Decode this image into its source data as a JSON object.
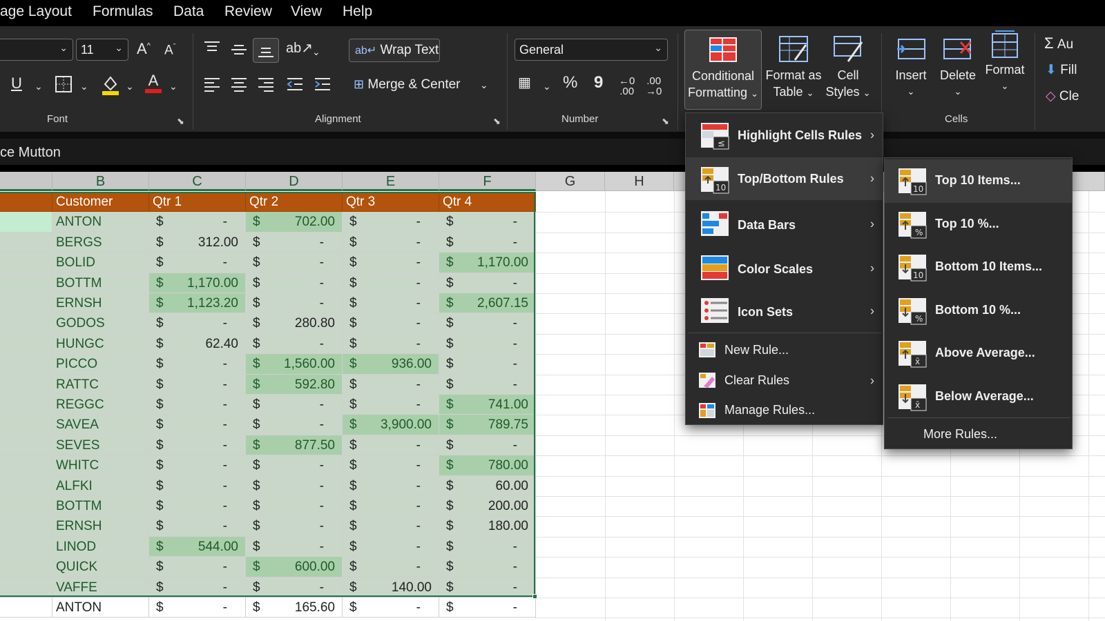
{
  "menubar": {
    "items": [
      "age Layout",
      "Formulas",
      "Data",
      "Review",
      "View",
      "Help"
    ]
  },
  "ribbon": {
    "font": {
      "size_value": "11",
      "grow_icon": "font-grow-icon",
      "shrink_icon": "font-shrink-icon",
      "group_label": "Font",
      "underline_glyph": "U",
      "color_glyph": "A",
      "fill_color": "#f5d800",
      "font_color": "#e01c1c"
    },
    "alignment": {
      "wrap_text": "Wrap Text",
      "merge_center": "Merge & Center",
      "group_label": "Alignment"
    },
    "number": {
      "format_value": "General",
      "percent_glyph": "%",
      "comma_glyph": "9",
      "group_label": "Number"
    },
    "styles": {
      "conditional_formatting": [
        "Conditional",
        "Formatting"
      ],
      "format_as_table": [
        "Format as",
        "Table"
      ],
      "cell_styles": [
        "Cell",
        "Styles"
      ]
    },
    "cells": {
      "insert": "Insert",
      "delete": "Delete",
      "format": "Format",
      "group_label": "Cells"
    },
    "editing": {
      "autosum": "Au",
      "fill": "Fill",
      "clear": "Cle"
    }
  },
  "formula_bar": {
    "text": "ce Mutton"
  },
  "sheet": {
    "columns": [
      "B",
      "C",
      "D",
      "E",
      "F",
      "G",
      "H"
    ],
    "headers": [
      "Customer",
      "Qtr 1",
      "Qtr 2",
      "Qtr 3",
      "Qtr 4"
    ],
    "currency_symbol": "$",
    "rows": [
      {
        "customer": "ANTON",
        "q": [
          "-",
          "702.00",
          "-",
          "-"
        ]
      },
      {
        "customer": "BERGS",
        "q": [
          "312.00",
          "-",
          "-",
          "-"
        ]
      },
      {
        "customer": "BOLID",
        "q": [
          "-",
          "-",
          "-",
          "1,170.00"
        ]
      },
      {
        "customer": "BOTTM",
        "q": [
          "1,170.00",
          "-",
          "-",
          "-"
        ]
      },
      {
        "customer": "ERNSH",
        "q": [
          "1,123.20",
          "-",
          "-",
          "2,607.15"
        ]
      },
      {
        "customer": "GODOS",
        "q": [
          "-",
          "280.80",
          "-",
          "-"
        ]
      },
      {
        "customer": "HUNGC",
        "q": [
          "62.40",
          "-",
          "-",
          "-"
        ]
      },
      {
        "customer": "PICCO",
        "q": [
          "-",
          "1,560.00",
          "936.00",
          "-"
        ]
      },
      {
        "customer": "RATTC",
        "q": [
          "-",
          "592.80",
          "-",
          "-"
        ]
      },
      {
        "customer": "REGGC",
        "q": [
          "-",
          "-",
          "-",
          "741.00"
        ]
      },
      {
        "customer": "SAVEA",
        "q": [
          "-",
          "-",
          "3,900.00",
          "789.75"
        ]
      },
      {
        "customer": "SEVES",
        "q": [
          "-",
          "877.50",
          "-",
          "-"
        ]
      },
      {
        "customer": "WHITC",
        "q": [
          "-",
          "-",
          "-",
          "780.00"
        ]
      },
      {
        "customer": "ALFKI",
        "q": [
          "-",
          "-",
          "-",
          "60.00"
        ]
      },
      {
        "customer": "BOTTM",
        "q": [
          "-",
          "-",
          "-",
          "200.00"
        ]
      },
      {
        "customer": "ERNSH",
        "q": [
          "-",
          "-",
          "-",
          "180.00"
        ]
      },
      {
        "customer": "LINOD",
        "q": [
          "544.00",
          "-",
          "-",
          "-"
        ]
      },
      {
        "customer": "QUICK",
        "q": [
          "-",
          "600.00",
          "-",
          "-"
        ]
      },
      {
        "customer": "VAFFE",
        "q": [
          "-",
          "-",
          "140.00",
          "-"
        ]
      },
      {
        "customer": "ANTON",
        "q": [
          "-",
          "165.60",
          "-",
          "-"
        ]
      }
    ],
    "highlighted": [
      [
        false,
        true,
        false,
        false
      ],
      [
        false,
        false,
        false,
        false
      ],
      [
        false,
        false,
        false,
        true
      ],
      [
        true,
        false,
        false,
        false
      ],
      [
        true,
        false,
        false,
        true
      ],
      [
        false,
        false,
        false,
        false
      ],
      [
        false,
        false,
        false,
        false
      ],
      [
        false,
        true,
        true,
        false
      ],
      [
        false,
        true,
        false,
        false
      ],
      [
        false,
        false,
        false,
        true
      ],
      [
        false,
        false,
        true,
        true
      ],
      [
        false,
        true,
        false,
        false
      ],
      [
        false,
        false,
        false,
        true
      ],
      [
        false,
        false,
        false,
        false
      ],
      [
        false,
        false,
        false,
        false
      ],
      [
        false,
        false,
        false,
        false
      ],
      [
        true,
        false,
        false,
        false
      ],
      [
        false,
        true,
        false,
        false
      ],
      [
        false,
        false,
        false,
        false
      ],
      [
        false,
        false,
        false,
        false
      ]
    ],
    "colors": {
      "header_fill": "#b4530b",
      "highlight_fill": "#a9cfaa",
      "selection_border": "#217346"
    }
  },
  "cf_menu": {
    "items": [
      {
        "label": "Highlight Cells Rules",
        "icon": "highlight-cells-icon",
        "submenu": true
      },
      {
        "label": "Top/Bottom Rules",
        "icon": "top-bottom-icon",
        "submenu": true,
        "active": true
      },
      {
        "label": "Data Bars",
        "icon": "data-bars-icon",
        "submenu": true
      },
      {
        "label": "Color Scales",
        "icon": "color-scales-icon",
        "submenu": true
      },
      {
        "label": "Icon Sets",
        "icon": "icon-sets-icon",
        "submenu": true
      }
    ],
    "actions": [
      {
        "label": "New Rule...",
        "icon": "new-rule-icon",
        "submenu": false
      },
      {
        "label": "Clear Rules",
        "icon": "clear-rules-icon",
        "submenu": true
      },
      {
        "label": "Manage Rules...",
        "icon": "manage-rules-icon",
        "submenu": false
      }
    ]
  },
  "topbottom_menu": {
    "items": [
      {
        "label": "Top 10 Items...",
        "icon": "top-10-items-icon",
        "badge": "10"
      },
      {
        "label": "Top 10 %...",
        "icon": "top-10-percent-icon",
        "badge": "%"
      },
      {
        "label": "Bottom 10 Items...",
        "icon": "bottom-10-items-icon",
        "badge": "10"
      },
      {
        "label": "Bottom 10 %...",
        "icon": "bottom-10-percent-icon",
        "badge": "%"
      },
      {
        "label": "Above Average...",
        "icon": "above-average-icon",
        "badge": "x̄"
      },
      {
        "label": "Below Average...",
        "icon": "below-average-icon",
        "badge": "x̄"
      }
    ],
    "more_rules": "More Rules..."
  }
}
